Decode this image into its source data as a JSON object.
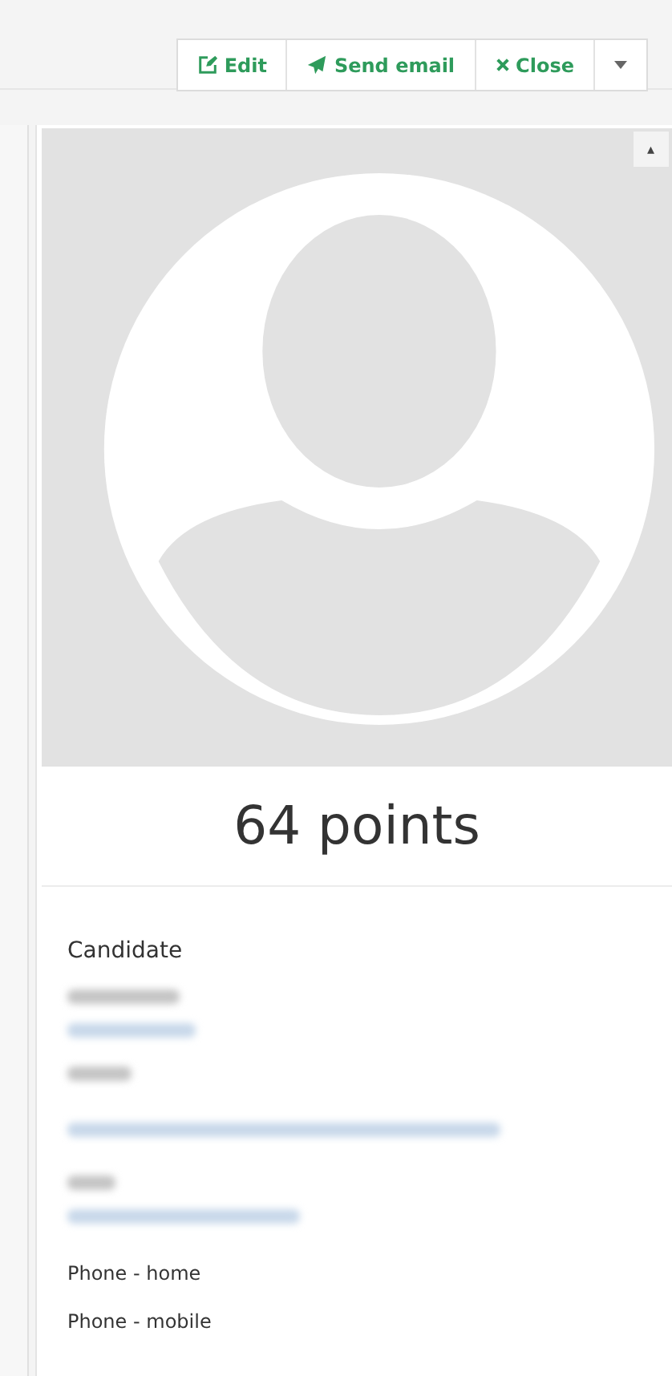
{
  "toolbar": {
    "buttons": [
      {
        "kind": "edit",
        "label": "Edit"
      },
      {
        "kind": "send",
        "label": "Send email"
      },
      {
        "kind": "close",
        "label": "Close"
      },
      {
        "kind": "menu"
      }
    ]
  },
  "profile": {
    "collapse_icon": "▴",
    "score": "64 points"
  },
  "candidate": {
    "title": "Candidate",
    "details": [
      {
        "kind": "redacted_label"
      },
      {
        "kind": "redacted_value"
      },
      {
        "kind": "redacted_label"
      },
      {
        "kind": "redacted_value_long"
      },
      {
        "kind": "redacted_label"
      },
      {
        "kind": "redacted_value"
      },
      {
        "kind": "field",
        "label": "Phone - home"
      },
      {
        "kind": "field",
        "label": "Phone - mobile"
      }
    ]
  }
}
